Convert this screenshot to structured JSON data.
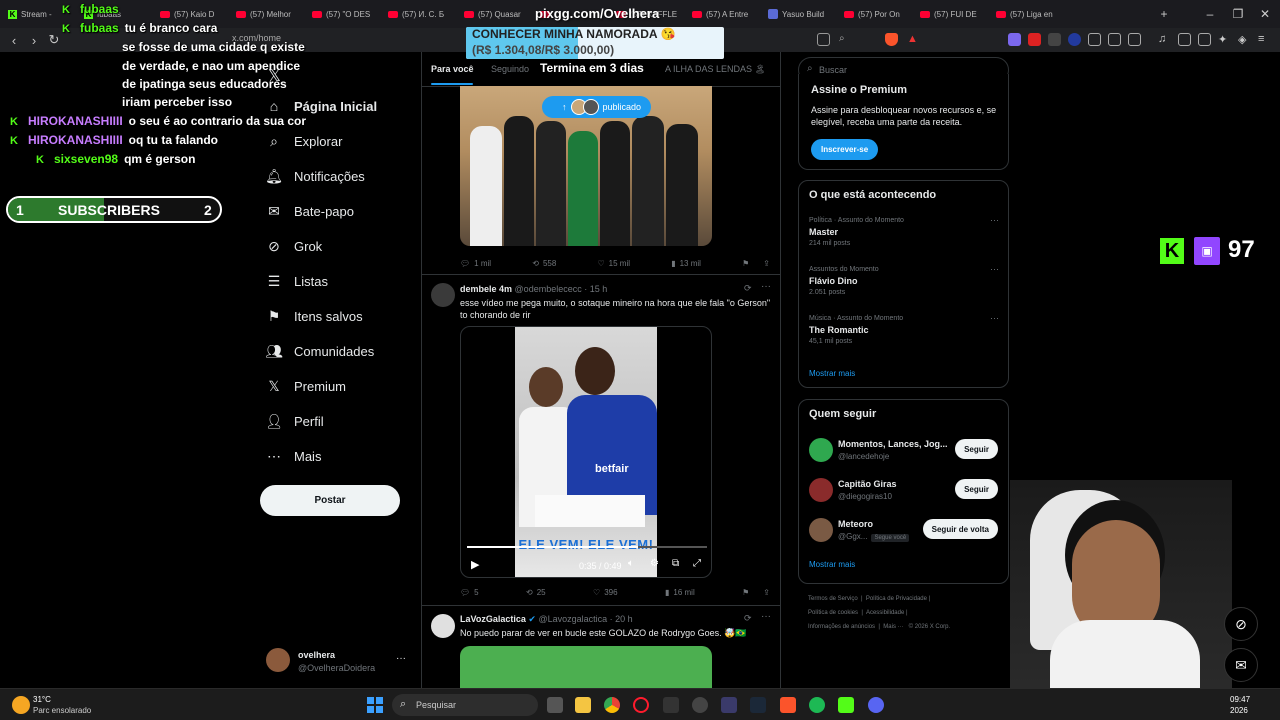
{
  "browser": {
    "tabs": [
      {
        "label": "Stream -",
        "icon": "kick"
      },
      {
        "label": "fubaas",
        "icon": "kick"
      },
      {
        "label": "(57) Kaio D",
        "icon": "youtube"
      },
      {
        "label": "(57) Melhor",
        "icon": "youtube"
      },
      {
        "label": "(57) \"O DES",
        "icon": "youtube"
      },
      {
        "label": "(57) И. С. Б",
        "icon": "youtube"
      },
      {
        "label": "(57) Quasar",
        "icon": "youtube"
      },
      {
        "label": "",
        "icon": "youtube"
      },
      {
        "label": "(57) RAFFLE",
        "icon": "youtube"
      },
      {
        "label": "(57) A Entre",
        "icon": "youtube"
      },
      {
        "label": "Yasuo Build",
        "icon": "other"
      },
      {
        "label": "(57) Por On",
        "icon": "youtube"
      },
      {
        "label": "(57) FUI DE",
        "icon": "youtube"
      },
      {
        "label": "(57) Liga en",
        "icon": "youtube"
      }
    ],
    "url": "x.com/home",
    "pixgg": "pixgg.com/Ovelhera",
    "donation_title": "CONHECER MINHA NAMORADA 😘",
    "donation_amount": "(R$ 1.304,08/R$ 3.000,00)",
    "donation_progress": 0.4347,
    "countdown": "Termina em 3 dias"
  },
  "chat": [
    {
      "user": "fubaas",
      "text": "",
      "color": "#53fc18"
    },
    {
      "user": "fubaas",
      "text": "tu é branco cara",
      "color": "#53fc18"
    },
    {
      "user": "",
      "text": "se fosse de uma cidade q existe",
      "color": "#ff4444"
    },
    {
      "user": "",
      "text": "de verdade, e nao um apendice",
      "color": "#ffffff"
    },
    {
      "user": "",
      "text": "de ipatinga seus educadores",
      "color": "#ffffff"
    },
    {
      "user": "",
      "text": "iriam perceber isso",
      "color": "#ffffff"
    },
    {
      "user": "HIROKANASHIIII",
      "text": "o seu é ao contrario da sua cor",
      "color": "#c77dff"
    },
    {
      "user": "HIROKANASHIIII",
      "text": "oq tu ta falando",
      "color": "#c77dff"
    },
    {
      "user": "sixseven98",
      "text": "qm é gerson",
      "color": "#53fc18"
    }
  ],
  "subgoal": {
    "left": "1",
    "label": "SUBSCRIBERS",
    "right": "2"
  },
  "viewer_count": "97",
  "sidebar": {
    "items": [
      {
        "label": "Página Inicial",
        "icon": "home-icon"
      },
      {
        "label": "Explorar",
        "icon": "search-icon"
      },
      {
        "label": "Notificações",
        "icon": "bell-icon"
      },
      {
        "label": "Bate-papo",
        "icon": "mail-icon"
      },
      {
        "label": "Grok",
        "icon": "grok-icon"
      },
      {
        "label": "Listas",
        "icon": "list-icon"
      },
      {
        "label": "Itens salvos",
        "icon": "bookmark-icon"
      },
      {
        "label": "Comunidades",
        "icon": "community-icon"
      },
      {
        "label": "Premium",
        "icon": "x-icon"
      },
      {
        "label": "Perfil",
        "icon": "person-icon"
      },
      {
        "label": "Mais",
        "icon": "more-icon"
      }
    ],
    "post_label": "Postar",
    "account_name": "ovelhera",
    "account_handle": "@OvelheraDoidera"
  },
  "feed": {
    "tabs": [
      "Para você",
      "Seguindo",
      "A ILHA DAS LENDAS 🏝"
    ],
    "published_pill": "publicado",
    "tweet1_actions": [
      "1 mil",
      "558",
      "15 mil",
      "13 mil"
    ],
    "tweet2": {
      "name": "dembele 4m",
      "handle": "@odembelececc",
      "time": "· 15 h",
      "text1": "esse vídeo me pega muito, o sotaque mineiro na hora que ele fala \"o Gerson\"",
      "text2": "to chorando de rir",
      "video_caption": "ELE VEM! ELE VEM!",
      "video_time": "0:35 / 0:49",
      "shirt": "betfair",
      "actions": [
        "5",
        "25",
        "396",
        "16 mil"
      ]
    },
    "tweet3": {
      "name": "LaVozGalactica",
      "handle": "@Lavozgalactica",
      "time": "· 20 h",
      "text": "No puedo parar de ver en bucle este GOLAZO de Rodrygo Goes. 🤯🇧🇷"
    }
  },
  "right": {
    "search_placeholder": "Buscar",
    "premium_title": "Assine o Premium",
    "premium_text": "Assine para desbloquear novos recursos e, se elegível, receba uma parte da receita.",
    "premium_button": "Inscrever-se",
    "trends_title": "O que está acontecendo",
    "trends": [
      {
        "category": "Política · Assunto do Momento",
        "name": "Master",
        "posts": "214 mil posts"
      },
      {
        "category": "Assuntos do Momento",
        "name": "Flávio Dino",
        "posts": "2.051 posts"
      },
      {
        "category": "Música · Assunto do Momento",
        "name": "The Romantic",
        "posts": "45,1 mil posts"
      }
    ],
    "show_more": "Mostrar mais",
    "follow_title": "Quem seguir",
    "follow": [
      {
        "name": "Momentos, Lances, Jog...",
        "handle": "@lancedehoje",
        "button": "Seguir",
        "badge": ""
      },
      {
        "name": "Capitão Giras",
        "handle": "@diegogiras10",
        "button": "Seguir",
        "badge": ""
      },
      {
        "name": "Meteoro",
        "handle": "@Ggx...",
        "button": "Seguir de volta",
        "badge": "Segue você"
      }
    ],
    "footer": [
      "Termos de Serviço",
      "Política de Privacidade",
      "Política de cookies",
      "Acessibilidade",
      "Informações de anúncios",
      "Mais ···",
      "© 2026 X Corp."
    ]
  },
  "taskbar": {
    "temp": "31°C",
    "weather": "Parc ensolarado",
    "search": "Pesquisar",
    "time": "09:47",
    "date": "2026"
  }
}
